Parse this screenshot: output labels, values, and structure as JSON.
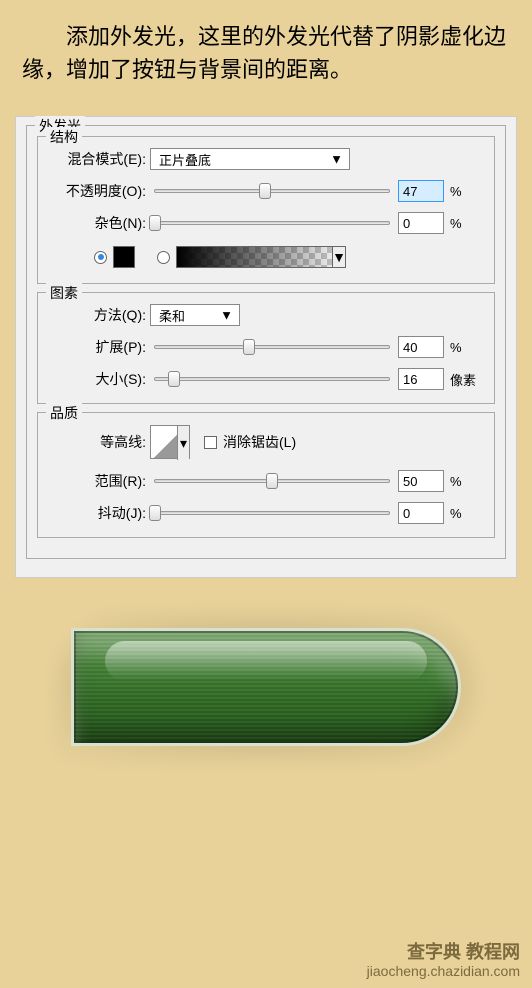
{
  "description": "添加外发光，这里的外发光代替了阴影虚化边缘，增加了按钮与背景间的距离。",
  "panel_title": "外发光",
  "structure": {
    "legend": "结构",
    "blend_mode_label": "混合模式(E):",
    "blend_mode_value": "正片叠底",
    "opacity_label": "不透明度(O):",
    "opacity_value": "47",
    "opacity_unit": "%",
    "noise_label": "杂色(N):",
    "noise_value": "0",
    "noise_unit": "%"
  },
  "elements": {
    "legend": "图素",
    "technique_label": "方法(Q):",
    "technique_value": "柔和",
    "spread_label": "扩展(P):",
    "spread_value": "40",
    "spread_unit": "%",
    "size_label": "大小(S):",
    "size_value": "16",
    "size_unit": "像素"
  },
  "quality": {
    "legend": "品质",
    "contour_label": "等高线:",
    "antialias_label": "消除锯齿(L)",
    "range_label": "范围(R):",
    "range_value": "50",
    "range_unit": "%",
    "jitter_label": "抖动(J):",
    "jitter_value": "0",
    "jitter_unit": "%"
  },
  "watermark": {
    "main": "查字典 教程网",
    "sub": "jiaocheng.chazidian.com"
  }
}
